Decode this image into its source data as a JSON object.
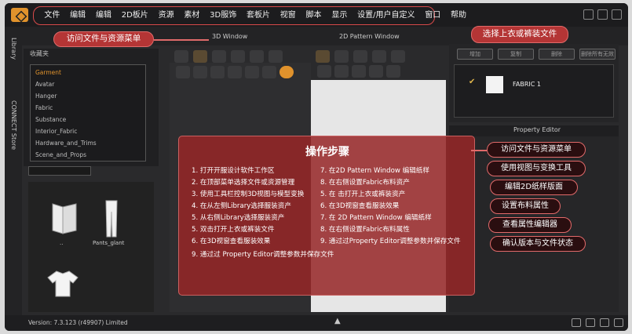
{
  "menu": [
    "文件",
    "编辑",
    "编辑",
    "2D板片",
    "资源",
    "素材",
    "3D服饰",
    "套板片",
    "视窗",
    "脚本",
    "显示",
    "设置/用户自定义",
    "窗口",
    "帮助"
  ],
  "callouts": {
    "access_menu": "访问文件与资源菜单",
    "select_garment": "选择上衣或裤装文件"
  },
  "left_rail": {
    "top": "Library",
    "bottom": "CONNECT Store"
  },
  "library": {
    "header": "收藏夹",
    "items": [
      "Garment",
      "Avatar",
      "Hanger",
      "Fabric",
      "Substance",
      "Interior_Fabric",
      "Hardware_and_Trims",
      "Scene_and_Props"
    ]
  },
  "thumbnails": [
    {
      "label": ".."
    },
    {
      "label": "Pants_glant"
    },
    {
      "label": ""
    }
  ],
  "views": {
    "view3d": "3D Window",
    "view2d": "2D Pattern Window"
  },
  "object_browser": {
    "buttons": [
      "增加",
      "复制",
      "删除",
      "删除所有无效"
    ],
    "fabric_name": "FABRIC 1"
  },
  "property_editor": {
    "title": "Property Editor"
  },
  "steps": {
    "title": "操作步骤",
    "left": [
      "1. 打开开服设计软件工作区",
      "2. 在顶部菜单选择文件或资源管理",
      "3. 使用工具栏控制3D视图与模型变换",
      "4. 在从左侧Library选择服装资产",
      "5. 从右侧Library选择服装资产",
      "5. 双击打开上衣或裤装文件",
      "6. 在3D视窗查看服装效果",
      "9. 通过过 Property Editor调整参数并保存文件"
    ],
    "right": [
      "7. 在2D Pattern Window 编辑纸样",
      "8. 在右侧设置Fabric布料资产",
      "5. 在 击打开上衣或裤装资产",
      "6. 在3D视窗查看服装效果",
      "7. 在 2D Pattern Window 编辑纸样",
      "8. 在右侧设置Fabric布料属性",
      "9. 通过过Property Editor调整参数并保存文件"
    ]
  },
  "right_callouts": [
    "访问文件与资源菜单",
    "使用视图与变换工具",
    "编辑2D纸样版面",
    "设置布料属性",
    "查看属性编辑器",
    "确认版本与文件状态"
  ],
  "status": {
    "version": "Version: 7.3.123 (r49907) Limited"
  },
  "colors": {
    "accent": "#e0922c",
    "callout": "#b43535",
    "panel": "#962628"
  }
}
